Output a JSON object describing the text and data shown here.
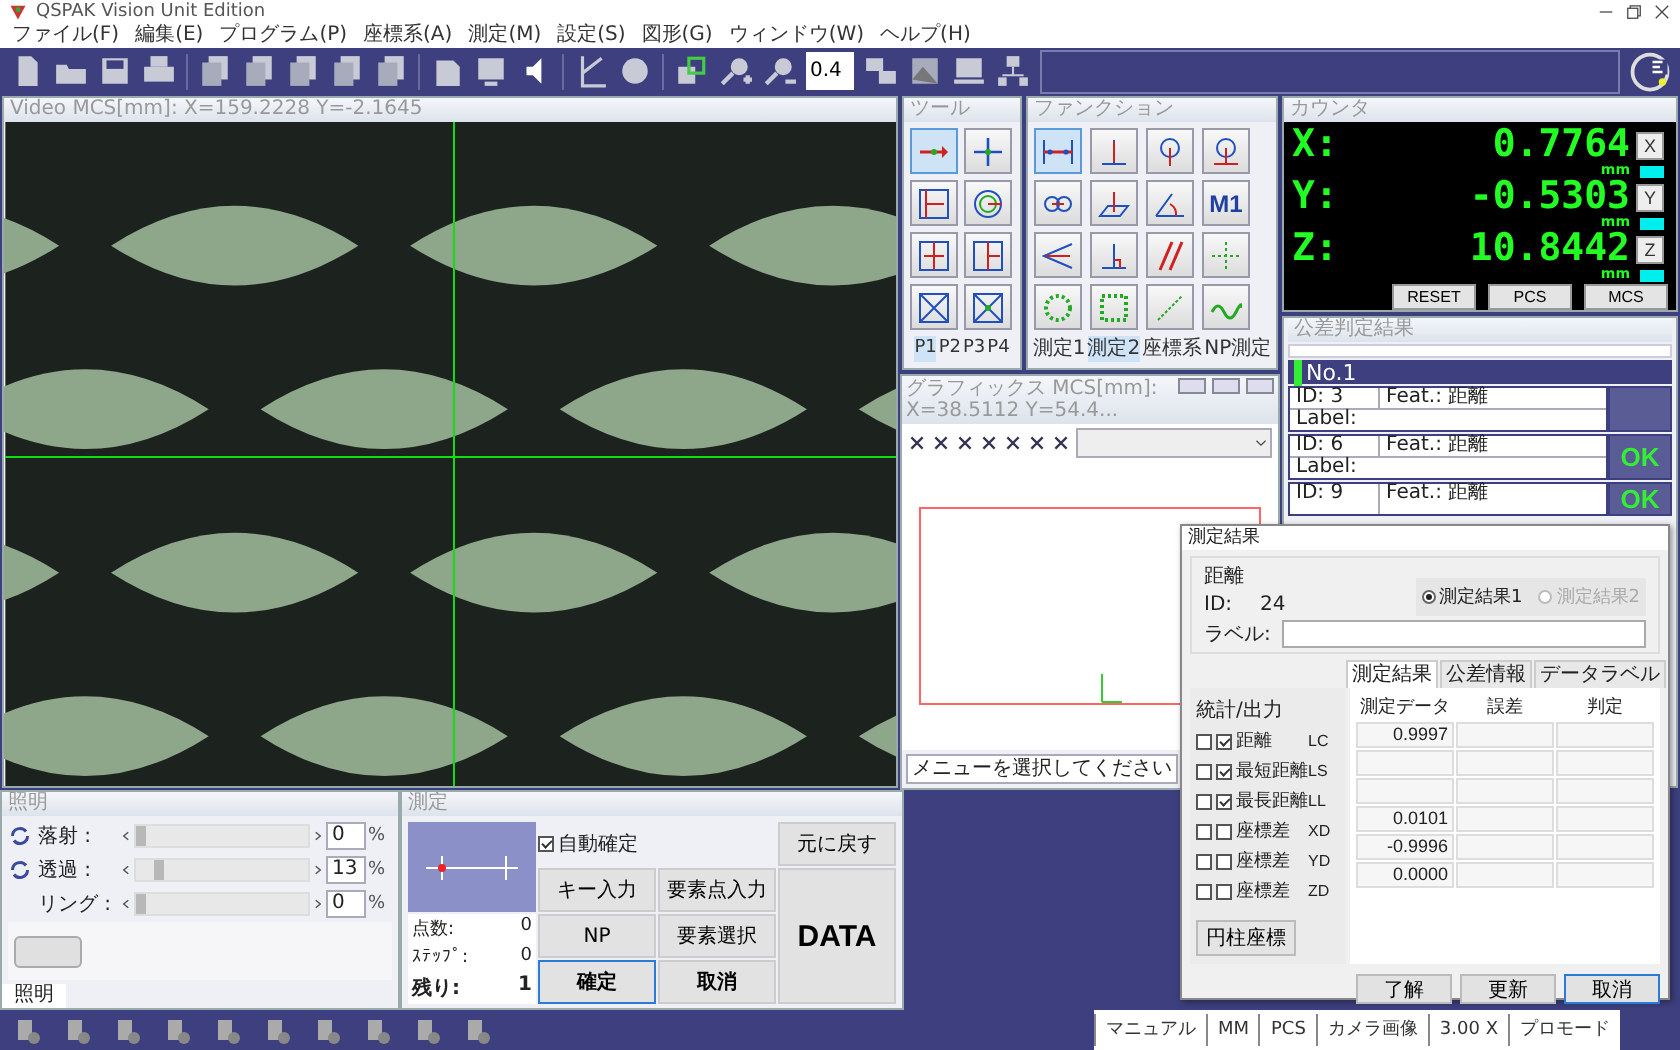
{
  "window": {
    "title": "QSPAK Vision Unit Edition"
  },
  "menu": [
    "ファイル(F)",
    "編集(E)",
    "プログラム(P)",
    "座標系(A)",
    "測定(M)",
    "設定(S)",
    "図形(G)",
    "ウィンドウ(W)",
    "ヘルプ(H)"
  ],
  "toolbar": {
    "zoom_value": "0.4"
  },
  "video": {
    "title": "Video   MCS[mm]: X=159.2228 Y=-2.1645"
  },
  "tool_panel": {
    "title": "ツール",
    "tabs": [
      {
        "label": "P1",
        "selected": true
      },
      {
        "label": "P2",
        "selected": false
      },
      {
        "label": "P3",
        "selected": false
      },
      {
        "label": "P4",
        "selected": false
      }
    ]
  },
  "function_panel": {
    "title": "ファンクション",
    "button_label": "M1",
    "tabs": [
      {
        "label": "測定1",
        "selected": false
      },
      {
        "label": "測定2",
        "selected": true
      },
      {
        "label": "座標系",
        "selected": false
      },
      {
        "label": "NP測定",
        "selected": false
      }
    ]
  },
  "counter": {
    "title": "カウンタ",
    "axes": [
      {
        "label": "X:",
        "value": "0.7764",
        "unit": "mm",
        "button": "X"
      },
      {
        "label": "Y:",
        "value": "-0.5303",
        "unit": "mm",
        "button": "Y"
      },
      {
        "label": "Z:",
        "value": "10.8442",
        "unit": "mm",
        "button": "Z"
      }
    ],
    "buttons": [
      "RESET",
      "PCS",
      "MCS"
    ]
  },
  "graphics": {
    "title": "グラフィックス MCS[mm]: X=38.5112 Y=54.4...",
    "status": "メニューを選択してください"
  },
  "tolerance": {
    "title": "公差判定結果",
    "header": "No.1",
    "rows": [
      {
        "id": "ID: 3",
        "feature": "Feat.: 距離",
        "label": "Label:"
      },
      {
        "id": "ID: 6",
        "feature": "Feat.: 距離",
        "label": "Label:",
        "result": "OK"
      },
      {
        "id": "ID: 9",
        "feature": "Feat.: 距離",
        "result": "OK"
      }
    ]
  },
  "illumination": {
    "title": "照明",
    "rows": [
      {
        "label": "落射 :",
        "sync": true,
        "level": 0,
        "value": "0",
        "unit": "%"
      },
      {
        "label": "透過 :",
        "sync": true,
        "level": 0.13,
        "value": "13",
        "unit": "%"
      },
      {
        "label": "リング :",
        "sync": false,
        "level": 0,
        "value": "0",
        "unit": "%"
      }
    ],
    "tab": "照明"
  },
  "measure": {
    "title": "測定",
    "counts": [
      {
        "label": "点数:",
        "value": "0",
        "emphasized": false
      },
      {
        "label": "ｽﾃｯﾌﾟ:",
        "value": "0",
        "emphasized": false
      },
      {
        "label": "残り:",
        "value": "1",
        "emphasized": true
      }
    ],
    "auto_confirm": {
      "label": "自動確定",
      "checked": true
    },
    "buttons": [
      {
        "label": "元に戻す",
        "kind": "normal",
        "selected": false
      },
      {
        "label": "キー入力",
        "kind": "normal",
        "selected": false
      },
      {
        "label": "要素点入力",
        "kind": "normal",
        "selected": false
      },
      {
        "label": "NP",
        "kind": "normal",
        "selected": false
      },
      {
        "label": "要素選択",
        "kind": "normal",
        "selected": false
      },
      {
        "label": "確定",
        "kind": "strong",
        "selected": true
      },
      {
        "label": "取消",
        "kind": "strong",
        "selected": false
      },
      {
        "label": "DATA",
        "kind": "big",
        "selected": false
      }
    ]
  },
  "dialog": {
    "title": "測定結果",
    "feature": "距離",
    "id_label": "ID:",
    "id_value": "24",
    "radios": [
      {
        "label": "測定結果1",
        "selected": true,
        "disabled": false
      },
      {
        "label": "測定結果2",
        "selected": false,
        "disabled": true
      }
    ],
    "label_field": {
      "label": "ラベル:"
    },
    "tabs": [
      {
        "label": "測定結果",
        "selected": true
      },
      {
        "label": "公差情報",
        "selected": false
      },
      {
        "label": "データラベル",
        "selected": false
      }
    ],
    "output_title": "統計/出力",
    "columns": [
      "測定データ",
      "誤差",
      "判定"
    ],
    "rows": [
      {
        "stat": false,
        "output": true,
        "name": "距離",
        "code": "LC",
        "value": "0.9997"
      },
      {
        "stat": false,
        "output": true,
        "name": "最短距離",
        "code": "LS"
      },
      {
        "stat": false,
        "output": true,
        "name": "最長距離",
        "code": "LL"
      },
      {
        "stat": false,
        "output": false,
        "name": "座標差",
        "code": "XD",
        "value": "0.0101"
      },
      {
        "stat": false,
        "output": false,
        "name": "座標差",
        "code": "YD",
        "value": "-0.9996"
      },
      {
        "stat": false,
        "output": false,
        "name": "座標差",
        "code": "ZD",
        "value": "0.0000"
      }
    ],
    "cylinder_button": "円柱座標",
    "buttons": [
      {
        "label": "了解",
        "focused": false
      },
      {
        "label": "更新",
        "focused": false
      },
      {
        "label": "取消",
        "focused": true
      }
    ]
  },
  "status_bar": {
    "items": [
      "マニュアル",
      "MM",
      "PCS",
      "カメラ画像",
      "3.00 X",
      "プロモード"
    ]
  }
}
